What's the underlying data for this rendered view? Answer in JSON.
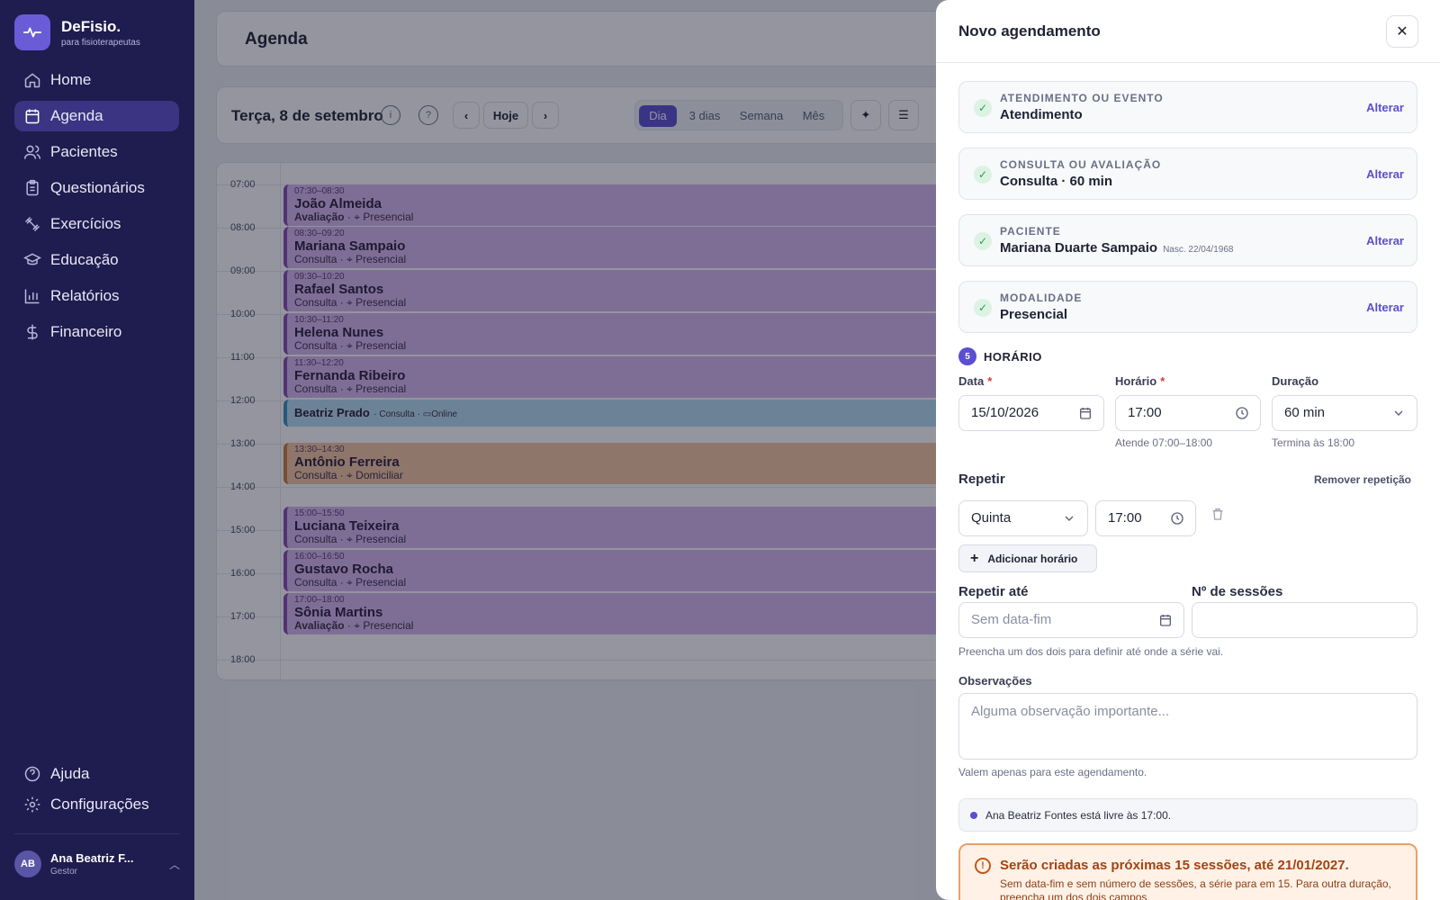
{
  "brand": {
    "name": "DeFisio.",
    "tagline": "para fisioterapeutas"
  },
  "nav": {
    "items": [
      {
        "label": "Home"
      },
      {
        "label": "Agenda"
      },
      {
        "label": "Pacientes"
      },
      {
        "label": "Questionários"
      },
      {
        "label": "Exercícios"
      },
      {
        "label": "Educação"
      },
      {
        "label": "Relatórios"
      },
      {
        "label": "Financeiro"
      }
    ],
    "bottom": [
      {
        "label": "Ajuda"
      },
      {
        "label": "Configurações"
      }
    ]
  },
  "user": {
    "initials": "AB",
    "name": "Ana Beatriz F...",
    "role": "Gestor"
  },
  "page": {
    "title": "Agenda"
  },
  "toolbar": {
    "date": "Terça, 8 de setembro",
    "today": "Hoje",
    "views": [
      "Dia",
      "3 dias",
      "Semana",
      "Mês"
    ],
    "active_view": "Dia"
  },
  "calendar": {
    "hours": [
      "07:00",
      "08:00",
      "09:00",
      "10:00",
      "11:00",
      "12:00",
      "13:00",
      "14:00",
      "15:00",
      "16:00",
      "17:00",
      "18:00"
    ],
    "events": [
      {
        "time": "07:30–08:30",
        "name": "João Almeida",
        "type": "Avaliação",
        "mode": "Presencial"
      },
      {
        "time": "08:30–09:20",
        "name": "Mariana Sampaio",
        "type": "Consulta",
        "mode": "Presencial"
      },
      {
        "time": "09:30–10:20",
        "name": "Rafael Santos",
        "type": "Consulta",
        "mode": "Presencial"
      },
      {
        "time": "10:30–11:20",
        "name": "Helena Nunes",
        "type": "Consulta",
        "mode": "Presencial"
      },
      {
        "time": "11:30–12:20",
        "name": "Fernanda Ribeiro",
        "type": "Consulta",
        "mode": "Presencial"
      },
      {
        "time": "",
        "name": "Beatriz Prado",
        "type": "Consulta",
        "mode": "Online"
      },
      {
        "time": "13:30–14:30",
        "name": "Antônio Ferreira",
        "type": "Consulta",
        "mode": "Domiciliar"
      },
      {
        "time": "15:00–15:50",
        "name": "Luciana Teixeira",
        "type": "Consulta",
        "mode": "Presencial"
      },
      {
        "time": "16:00–16:50",
        "name": "Gustavo Rocha",
        "type": "Consulta",
        "mode": "Presencial"
      },
      {
        "time": "17:00–18:00",
        "name": "Sônia Martins",
        "type": "Avaliação",
        "mode": "Presencial"
      }
    ]
  },
  "drawer": {
    "title": "Novo agendamento",
    "steps": [
      {
        "label": "ATENDIMENTO OU EVENTO",
        "value": "Atendimento",
        "note": "",
        "action": "Alterar"
      },
      {
        "label": "CONSULTA OU AVALIAÇÃO",
        "value": "Consulta · 60 min",
        "note": "",
        "action": "Alterar"
      },
      {
        "label": "PACIENTE",
        "value": "Mariana Duarte Sampaio",
        "note": "Nasc. 22/04/1968",
        "action": "Alterar"
      },
      {
        "label": "MODALIDADE",
        "value": "Presencial",
        "note": "",
        "action": "Alterar"
      }
    ],
    "section": {
      "number": "5",
      "title": "HORÁRIO"
    },
    "date": {
      "label": "Data",
      "value": "15/10/2026"
    },
    "time": {
      "label": "Horário",
      "value": "17:00",
      "hint": "Atende 07:00–18:00"
    },
    "duration": {
      "label": "Duração",
      "value": "60 min",
      "hint": "Termina às 18:00"
    },
    "repeat": {
      "title": "Repetir",
      "remove": "Remover repetição",
      "day": "Quinta",
      "time": "17:00",
      "add": "Adicionar horário"
    },
    "until": {
      "label": "Repetir até",
      "placeholder": "Sem data-fim"
    },
    "sessions": {
      "label": "Nº de sessões",
      "value": ""
    },
    "until_hint": "Preencha um dos dois para definir até onde a série vai.",
    "notes": {
      "label": "Observações",
      "placeholder": "Alguma observação importante...",
      "hint": "Valem apenas para este agendamento."
    },
    "availability": "Ana Beatriz Fontes está livre às 17:00.",
    "warning": {
      "title": "Serão criadas as próximas 15 sessões, até 21/01/2027.",
      "text": "Sem data-fim e sem número de sessões, a série para em 15. Para outra duração, preencha um dos dois campos."
    }
  },
  "colors": {
    "accent": "#5b4fd0",
    "sidebar": "#1f1c4f",
    "event_purple": "#d8b8f0",
    "event_blue": "#b6def2",
    "event_orange": "#f6c6a2"
  }
}
